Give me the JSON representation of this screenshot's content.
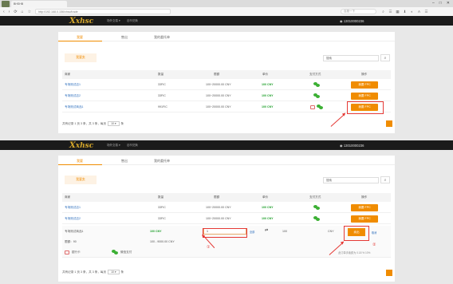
{
  "browser": {
    "tab_title": "BHSHB",
    "address": "http://192.168.0.156/xhsc/trade",
    "search_placeholder": "百度一下",
    "window_controls": [
      "–",
      "□",
      "✕"
    ],
    "nav_icons": [
      "‹",
      "›",
      "⟳",
      "⌂",
      "☆"
    ],
    "toolbar_icons": [
      "⌕",
      "☰",
      "▦",
      "⬇",
      "◐",
      "A",
      "☰"
    ]
  },
  "header": {
    "logo_letter": "X",
    "logo_text": "xhsc",
    "nav_links": [
      "场外交易 ▾",
      "法币兑换"
    ],
    "phone": "◉ 13010000236"
  },
  "tabs": [
    "我要",
    "售出",
    "我的委托单"
  ],
  "subtab": "我要卖",
  "search": {
    "placeholder": "搜索",
    "icon": "⌕"
  },
  "table": {
    "columns": [
      "商家",
      "数量",
      "限额",
      "单价",
      "支付方式",
      "操作"
    ],
    "rows": [
      {
        "merchant": "专场测试店1",
        "amount": "33FIC",
        "limit": "100~20000.00 CNY",
        "price": "100 CNY",
        "action": "我要 FPC"
      },
      {
        "merchant": "专场测试店2",
        "amount": "33FIC",
        "limit": "100~20000.00 CNY",
        "price": "100 CNY",
        "action": "我要 FPC"
      },
      {
        "merchant": "专场测试商品1",
        "amount": "991FIC",
        "limit": "100~20000.00 CNY",
        "price": "100 CNY",
        "action": "我要 FPC"
      }
    ]
  },
  "pager": {
    "text": "共有记录 1 页 3 条，共 3 条，每页",
    "per_page": "10 ▾",
    "suffix": "条"
  },
  "expanded": {
    "merchant": "专场测试商品1",
    "price": "100 CNY",
    "limit_label": "限额：90",
    "limit_range": "100 - 9000.00 CNY",
    "qty_value": "1",
    "qty_unit": "全部",
    "equal_icon": "⇄",
    "total_value": "100",
    "total_unit": "CNY",
    "confirm": "卖出",
    "cancel": "取消",
    "bank_label": "银行卡",
    "wechat_label": "微信支付",
    "fee_note": "此订单手续费为 0.18 % 10%"
  },
  "annotations": {
    "one": "①",
    "two": "②"
  },
  "colors": {
    "accent": "#f08c00",
    "link": "#2e6fbd",
    "price": "#23a12f",
    "highlight": "#e53935"
  }
}
